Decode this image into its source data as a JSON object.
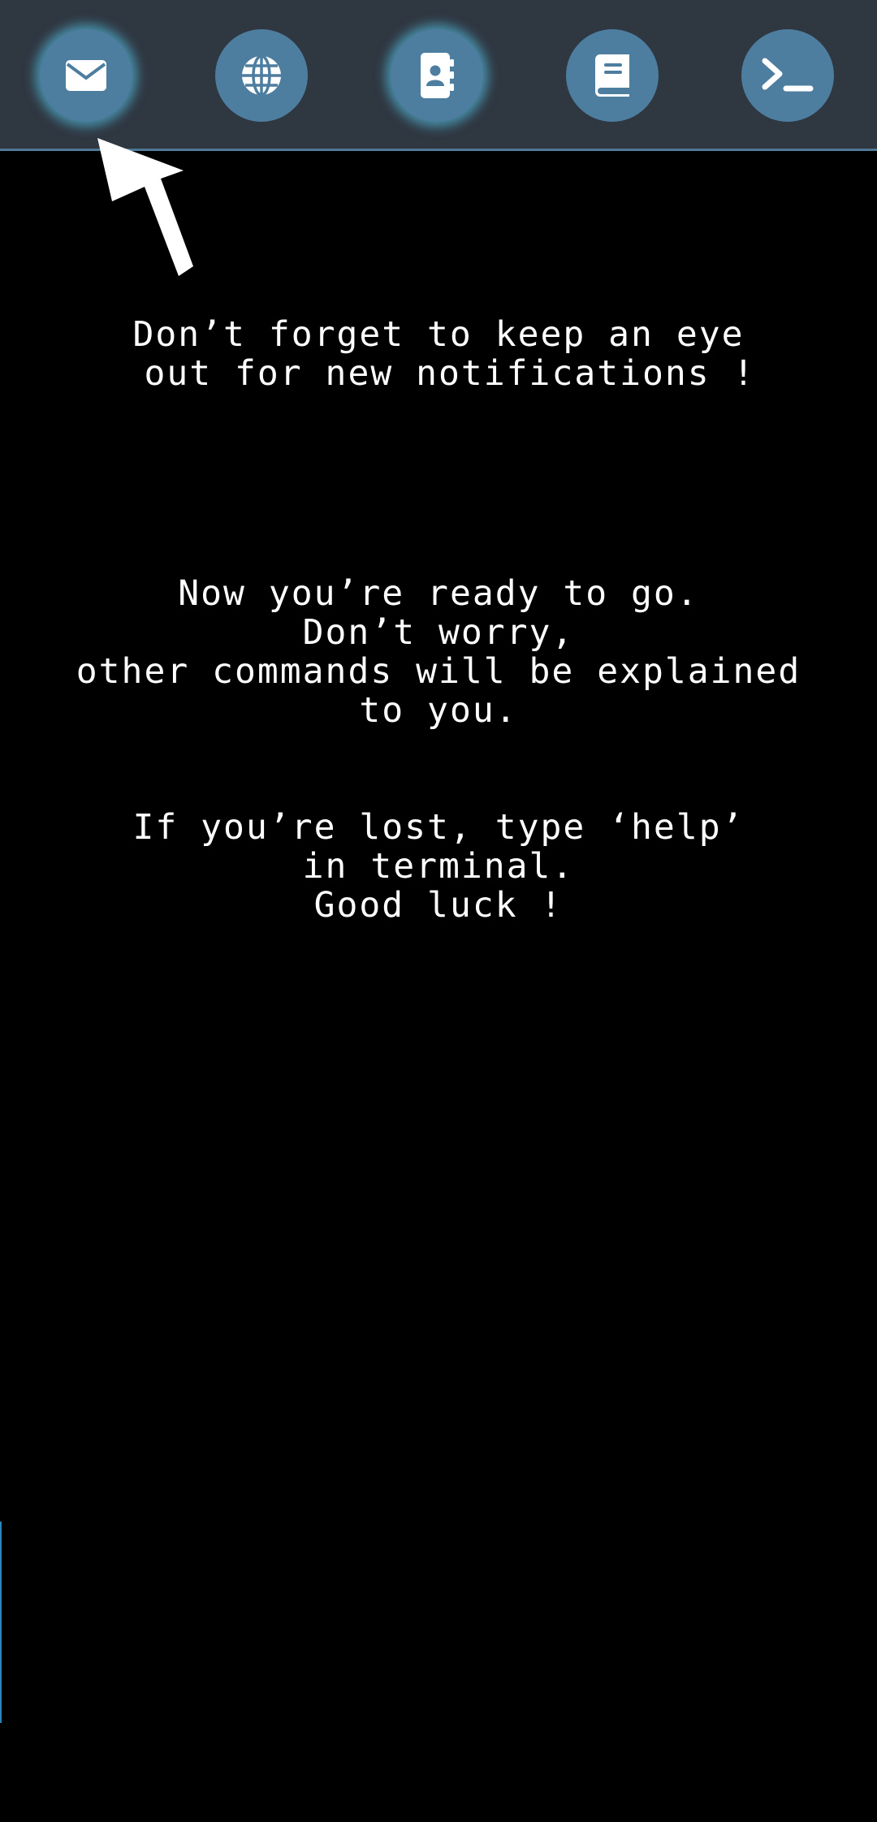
{
  "topbar": {
    "apps": [
      {
        "name": "mail",
        "icon": "envelope-icon"
      },
      {
        "name": "browser",
        "icon": "globe-icon"
      },
      {
        "name": "contacts",
        "icon": "address-book-icon"
      },
      {
        "name": "book",
        "icon": "book-icon"
      },
      {
        "name": "terminal",
        "icon": "terminal-prompt-icon"
      }
    ],
    "highlighted": [
      "mail",
      "contacts"
    ]
  },
  "tutorial": {
    "notification_tip": "Don’t forget to keep an eye\n out for new notifications !",
    "ready_message": "Now you’re ready to go.\nDon’t worry,\nother commands will be explained\nto you.",
    "help_message": "If you’re lost, type ‘help’\nin terminal.\nGood luck !"
  },
  "colors": {
    "background": "#000000",
    "topbar": "#2f3741",
    "button": "#4d7d9f",
    "glow": "#50afcd",
    "text": "#ffffff"
  }
}
